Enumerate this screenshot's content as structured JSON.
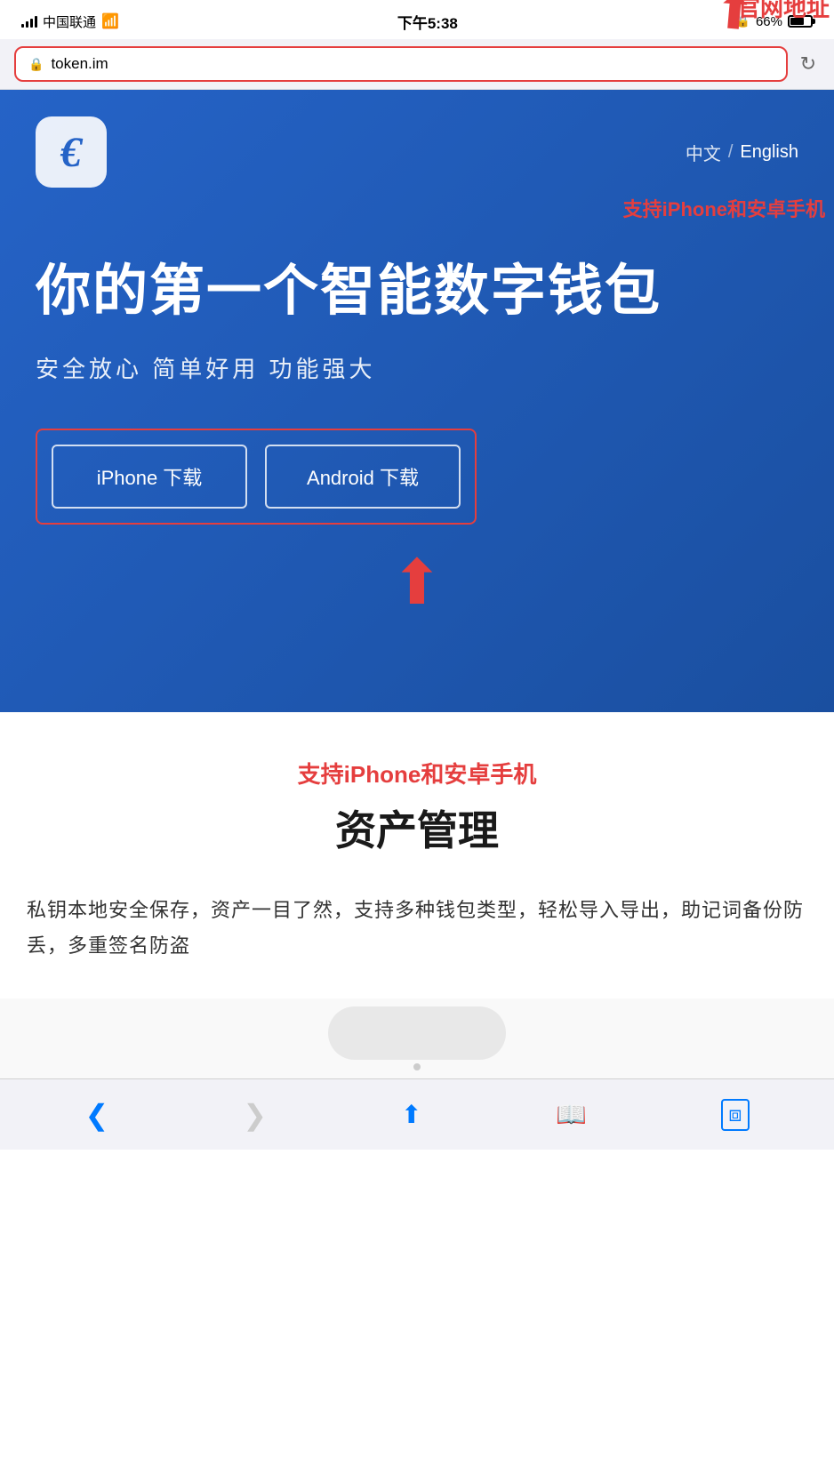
{
  "status_bar": {
    "carrier": "中国联通",
    "time": "下午5:38",
    "battery_percent": "66%"
  },
  "browser": {
    "url": "token.im",
    "lock_symbol": "🔒",
    "refresh_label": "↻"
  },
  "annotation": {
    "url_label": "官网地址",
    "iphone_android_label": "支持iPhone和安卓手机"
  },
  "hero": {
    "logo_char": "c",
    "lang_cn": "中文",
    "lang_divider": "/",
    "lang_en": "English",
    "title": "你的第一个智能数字钱包",
    "subtitle": "安全放心  简单好用  功能强大",
    "iphone_btn": "iPhone 下载",
    "android_btn": "Android 下载"
  },
  "content": {
    "annotation": "支持iPhone和安卓手机",
    "title": "资产管理",
    "description": "私钥本地安全保存，资产一目了然，支持多种钱包类型，轻松导入导出，助记词备份防丢，多重签名防盗"
  },
  "browser_nav": {
    "back": "‹",
    "forward": "›",
    "share": "↑",
    "bookmarks": "□□",
    "tabs": "⧉"
  }
}
